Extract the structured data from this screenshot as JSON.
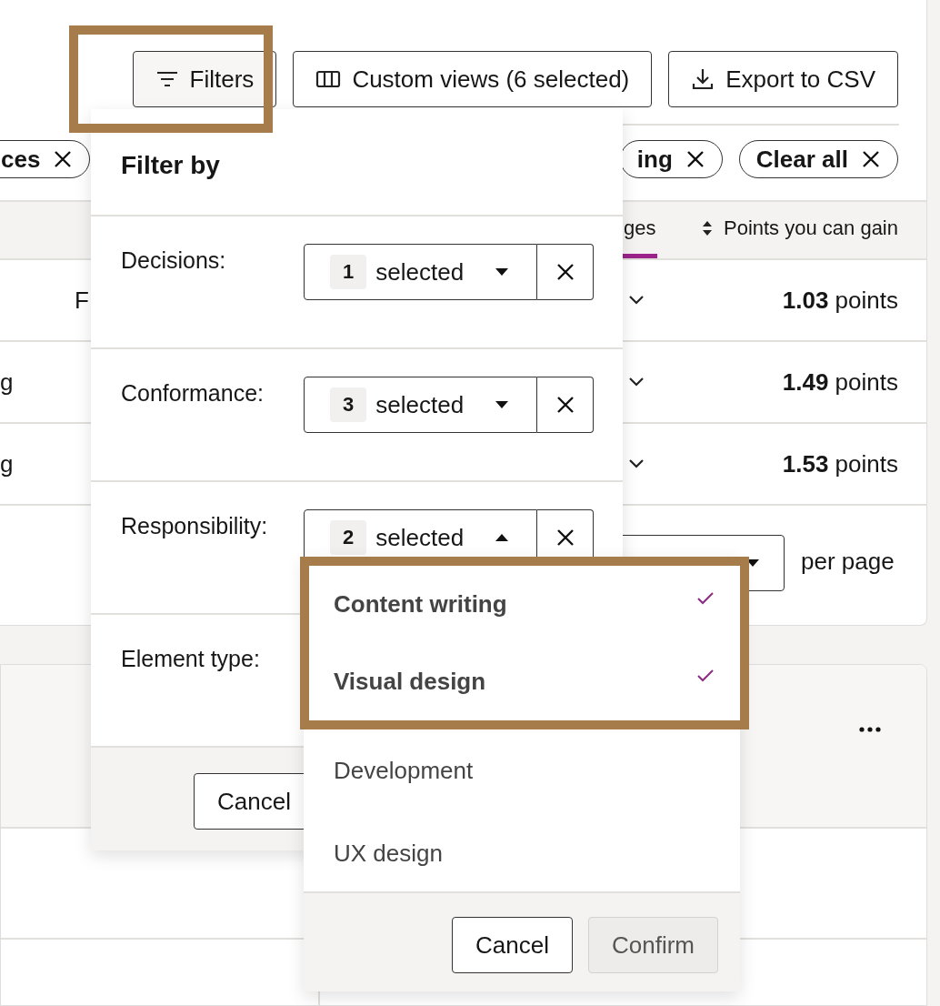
{
  "toolbar": {
    "buttons": [
      {
        "kind": "filters",
        "label": "Filters"
      },
      {
        "kind": "columns",
        "label": "Custom views (6 selected)"
      },
      {
        "kind": "export",
        "label": "Export to CSV"
      }
    ]
  },
  "filter_chips": [
    {
      "label": "ces"
    },
    {
      "label": "ing"
    },
    {
      "label": "Clear all"
    }
  ],
  "table": {
    "columns": [
      {
        "label": "ges",
        "sorted": true
      },
      {
        "label": "Points you can gain",
        "sorted": false
      }
    ],
    "rows": [
      {
        "column_2": "F",
        "points": "**1.03** points"
      },
      {
        "column_1": "g",
        "points": "**1.49** points"
      },
      {
        "column_1": "g",
        "points": "**1.53** points"
      }
    ]
  },
  "pagination": {
    "per_page_label": "per page"
  },
  "filter_panel": {
    "title": "Filter by",
    "filters": [
      {
        "label": "Decisions:",
        "count": "1",
        "value": "selected",
        "expanded": false
      },
      {
        "label": "Conformance:",
        "count": "3",
        "value": "selected",
        "expanded": false
      },
      {
        "label": "Responsibility:",
        "count": "2",
        "value": "selected",
        "expanded": true
      },
      {
        "label": "Element type:"
      }
    ],
    "buttons": [
      "Cancel"
    ]
  },
  "dropdown": {
    "options": [
      {
        "label": "Content writing",
        "selected": true
      },
      {
        "label": "Visual design",
        "selected": true
      },
      {
        "label": "Development",
        "selected": false
      },
      {
        "label": "UX design",
        "selected": false
      }
    ],
    "buttons": [
      {
        "label": "Cancel",
        "disabled": false
      },
      {
        "label": "Confirm",
        "disabled": true
      }
    ]
  }
}
